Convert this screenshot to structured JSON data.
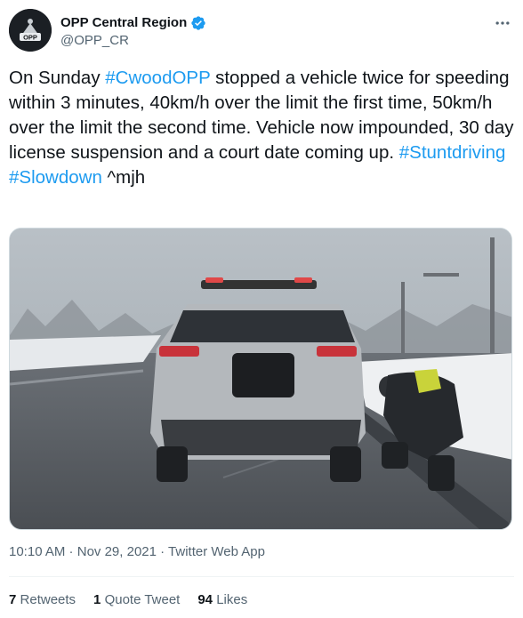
{
  "account": {
    "display_name": "OPP Central Region",
    "handle": "@OPP_CR",
    "avatar_icon": "opp-badge-icon",
    "avatar_badge_text": "OPP",
    "verified_icon": "verified-badge-icon",
    "verified_color": "#1d9bf0"
  },
  "tweet": {
    "segments": [
      {
        "text": "On Sunday ",
        "type": "text"
      },
      {
        "text": "#CwoodOPP",
        "type": "hashtag"
      },
      {
        "text": " stopped a vehicle twice for speeding within 3 minutes, 40km/h over the limit the first time, 50km/h over the limit the second time. Vehicle now impounded, 30 day license suspension and a court date coming up.  ",
        "type": "text"
      },
      {
        "text": "#Stuntdriving",
        "type": "hashtag"
      },
      {
        "text": " ",
        "type": "text"
      },
      {
        "text": "#Slowdown",
        "type": "hashtag"
      },
      {
        "text": " ^mjh",
        "type": "text"
      }
    ],
    "link_color": "#1d9bf0"
  },
  "meta": {
    "time": "10:10 AM",
    "dot1": " · ",
    "date": "Nov 29, 2021",
    "dot2": " · ",
    "source": "Twitter Web App"
  },
  "stats": {
    "retweets_count": "7",
    "retweets_label": "Retweets",
    "quotes_count": "1",
    "quotes_label": "Quote Tweet",
    "likes_count": "94",
    "likes_label": "Likes"
  },
  "icons": {
    "more": "more-icon"
  }
}
